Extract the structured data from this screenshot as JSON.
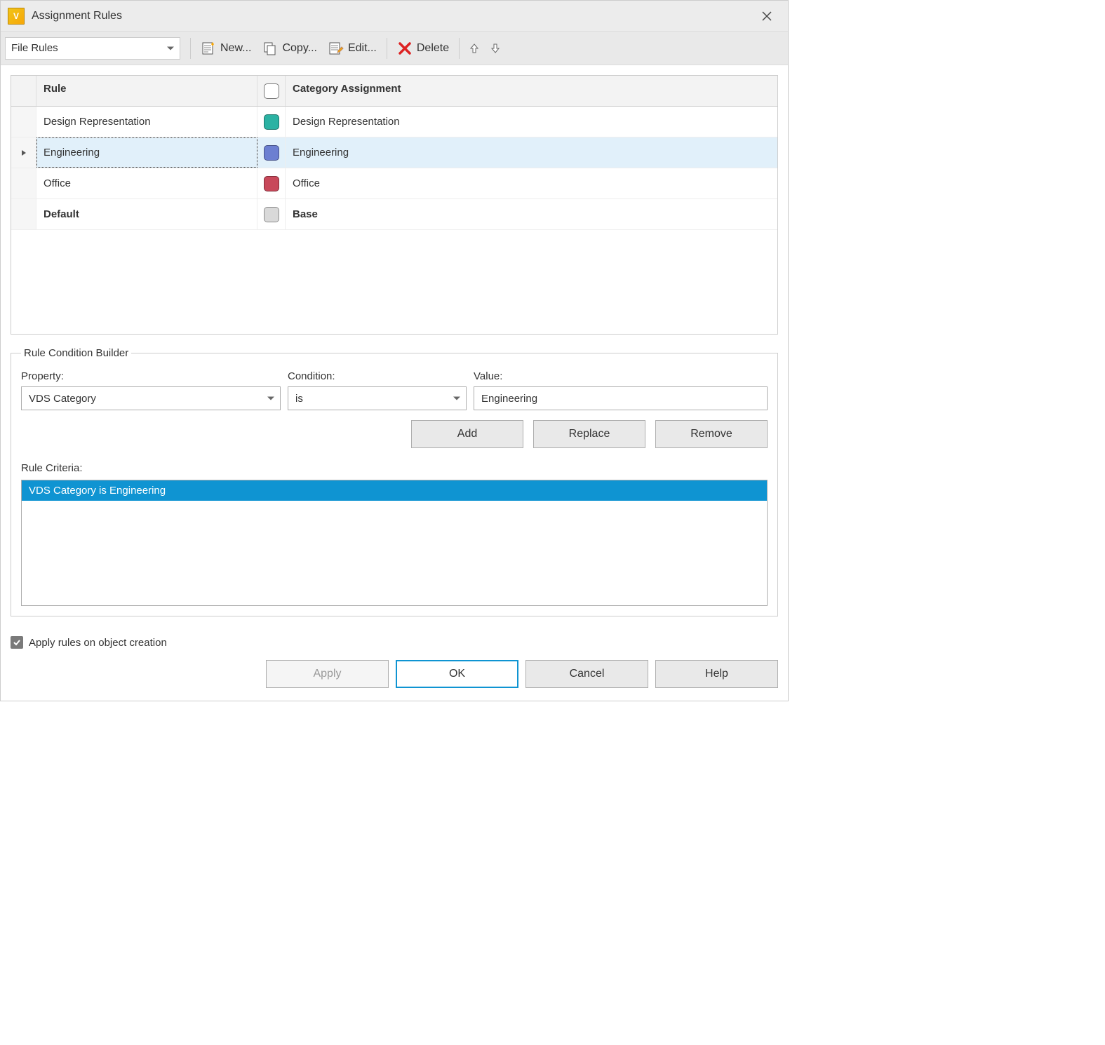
{
  "window": {
    "title": "Assignment Rules"
  },
  "toolbar": {
    "type_selector": "File Rules",
    "new_label": "New...",
    "copy_label": "Copy...",
    "edit_label": "Edit...",
    "delete_label": "Delete"
  },
  "grid": {
    "headers": {
      "rule": "Rule",
      "category": "Category Assignment"
    },
    "rows": [
      {
        "rule": "Design Representation",
        "category": "Design Representation",
        "color": "#2bb2a3",
        "selected": false,
        "bold": false
      },
      {
        "rule": "Engineering",
        "category": "Engineering",
        "color": "#6c7fd1",
        "selected": true,
        "bold": false
      },
      {
        "rule": "Office",
        "category": "Office",
        "color": "#c8485a",
        "selected": false,
        "bold": false
      },
      {
        "rule": "Default",
        "category": "Base",
        "color": "#d9d9d9",
        "selected": false,
        "bold": true
      }
    ]
  },
  "builder": {
    "legend": "Rule Condition Builder",
    "labels": {
      "property": "Property:",
      "condition": "Condition:",
      "value": "Value:",
      "criteria": "Rule Criteria:"
    },
    "property": "VDS Category",
    "condition": "is",
    "value": "Engineering",
    "buttons": {
      "add": "Add",
      "replace": "Replace",
      "remove": "Remove"
    },
    "criteria": [
      {
        "text": "VDS Category is Engineering",
        "selected": true
      }
    ]
  },
  "footer": {
    "apply_checkbox": {
      "label": "Apply rules on object creation",
      "checked": true
    },
    "buttons": {
      "apply": "Apply",
      "ok": "OK",
      "cancel": "Cancel",
      "help": "Help"
    }
  }
}
